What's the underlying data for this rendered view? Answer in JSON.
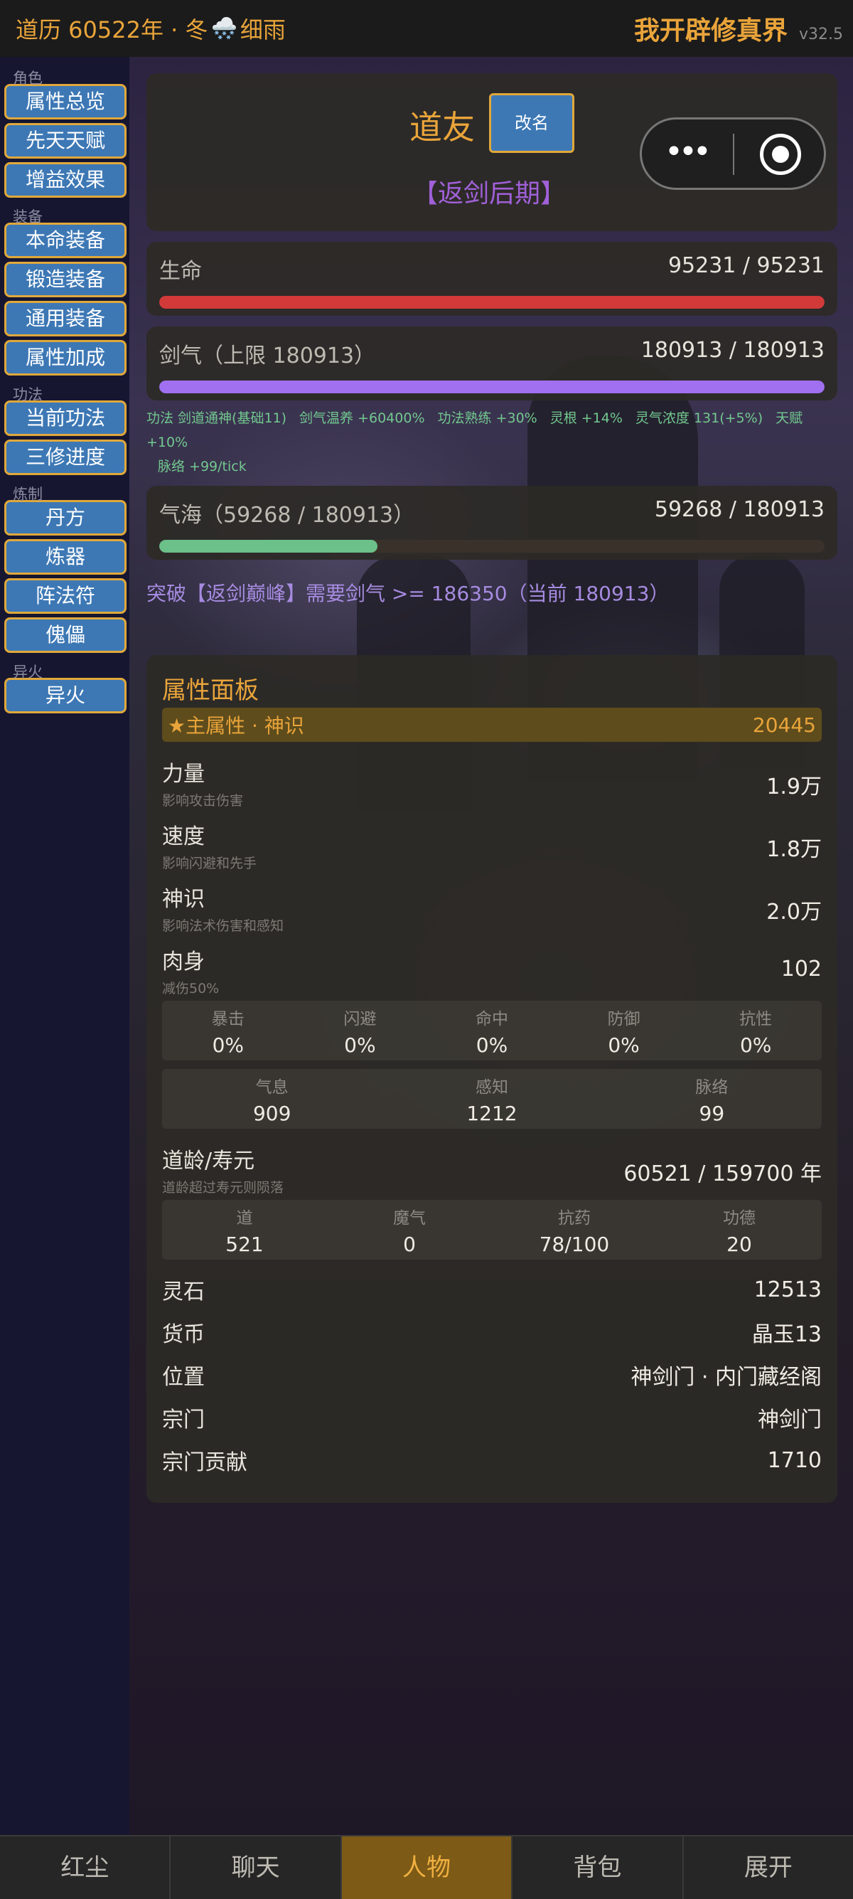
{
  "topbar": {
    "calendar": "道历 60522年 · 冬",
    "weather_icon": "🌨️",
    "weather": "细雨",
    "game_title": "我开辟修真界",
    "version": "v32.5"
  },
  "sidebar": {
    "groups": [
      {
        "label": "角色",
        "items": [
          "属性总览",
          "先天天赋",
          "增益效果"
        ]
      },
      {
        "label": "装备",
        "items": [
          "本命装备",
          "锻造装备",
          "通用装备",
          "属性加成"
        ]
      },
      {
        "label": "功法",
        "items": [
          "当前功法",
          "三修进度"
        ]
      },
      {
        "label": "炼制",
        "items": [
          "丹方",
          "炼器",
          "阵法符",
          "傀儡"
        ]
      },
      {
        "label": "异火",
        "items": [
          "异火"
        ]
      }
    ]
  },
  "profile": {
    "name": "道友",
    "rename_label": "改名",
    "realm": "【返剑后期】"
  },
  "bars": {
    "hp": {
      "label": "生命",
      "value": "95231 / 95231",
      "fraction": 1.0,
      "color": "#d23a3a"
    },
    "sword": {
      "label": "剑气（上限 180913）",
      "value": "180913 / 180913",
      "fraction": 1.0,
      "color": "#a070f0"
    },
    "sea": {
      "label": "气海（59268 / 180913）",
      "value": "59268 / 180913",
      "fraction": 0.3276,
      "color": "#6cc08a"
    }
  },
  "buffs": {
    "line1": [
      "功法 剑道通神(基础11)",
      "剑气温养 +60400%",
      "功法熟练 +30%",
      "灵根 +14%",
      "灵气浓度 131(+5%)",
      "天赋 +10%"
    ],
    "line2": [
      "脉络 +99/tick"
    ]
  },
  "breakthrough": "突破【返剑巅峰】需要剑气 >= 186350（当前 180913）",
  "panel": {
    "title": "属性面板",
    "main_attr_label": "★主属性 · 神识",
    "main_attr_value": "20445",
    "attrs": [
      {
        "name": "力量",
        "desc": "影响攻击伤害",
        "value": "1.9万"
      },
      {
        "name": "速度",
        "desc": "影响闪避和先手",
        "value": "1.8万"
      },
      {
        "name": "神识",
        "desc": "影响法术伤害和感知",
        "value": "2.0万"
      },
      {
        "name": "肉身",
        "desc": "减伤50%",
        "value": "102"
      }
    ],
    "combat": [
      {
        "k": "暴击",
        "v": "0%"
      },
      {
        "k": "闪避",
        "v": "0%"
      },
      {
        "k": "命中",
        "v": "0%"
      },
      {
        "k": "防御",
        "v": "0%"
      },
      {
        "k": "抗性",
        "v": "0%"
      }
    ],
    "inner": [
      {
        "k": "气息",
        "v": "909"
      },
      {
        "k": "感知",
        "v": "1212"
      },
      {
        "k": "脉络",
        "v": "99"
      }
    ],
    "age": {
      "name": "道龄/寿元",
      "desc": "道龄超过寿元则陨落",
      "value": "60521 / 159700 年"
    },
    "dao": [
      {
        "k": "道",
        "v": "521"
      },
      {
        "k": "魔气",
        "v": "0"
      },
      {
        "k": "抗药",
        "v": "78/100"
      },
      {
        "k": "功德",
        "v": "20"
      }
    ],
    "kv": [
      {
        "k": "灵石",
        "v": "12513"
      },
      {
        "k": "货币",
        "v": "晶玉13"
      },
      {
        "k": "位置",
        "v": "神剑门 · 内门藏经阁"
      },
      {
        "k": "宗门",
        "v": "神剑门"
      },
      {
        "k": "宗门贡献",
        "v": "1710"
      }
    ]
  },
  "tabs": [
    {
      "label": "红尘",
      "active": false
    },
    {
      "label": "聊天",
      "active": false
    },
    {
      "label": "人物",
      "active": true
    },
    {
      "label": "背包",
      "active": false
    },
    {
      "label": "展开",
      "active": false
    }
  ]
}
